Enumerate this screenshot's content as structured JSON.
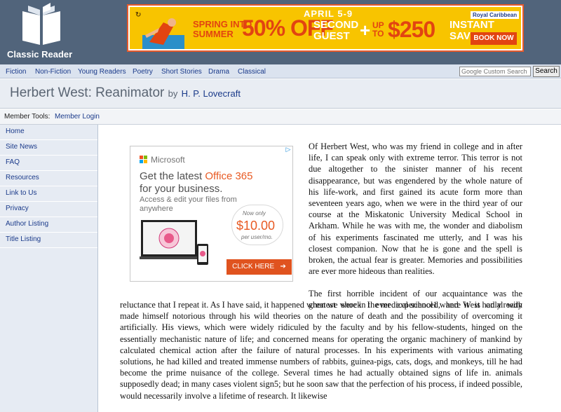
{
  "site": {
    "name": "Classic Reader"
  },
  "banner": {
    "dates": "APRIL 5-9",
    "spring": "SPRING INTO",
    "summer": "SUMMER",
    "off": "50% OFF",
    "second": "SECOND",
    "guest": "GUEST",
    "upto_line1": "UP",
    "upto_line2": "TO",
    "amount": "$250",
    "instant": "INSTANT",
    "savings": "SAVINGS",
    "brand": "Royal Caribbean",
    "cta": "BOOK NOW"
  },
  "nav": {
    "items": [
      "Fiction",
      "Non-Fiction",
      "Young Readers",
      "Poetry",
      "Short Stories",
      "Drama",
      "Classical"
    ]
  },
  "search": {
    "placeholder": "Google Custom Search",
    "button": "Search"
  },
  "book": {
    "title": "Herbert West: Reanimator",
    "by": "by",
    "author": "H. P. Lovecraft"
  },
  "member": {
    "label": "Member Tools:",
    "login": "Member Login"
  },
  "sidebar": {
    "items": [
      "Home",
      "Site News",
      "FAQ",
      "Resources",
      "Link to Us",
      "Privacy",
      "Author Listing",
      "Title Listing"
    ]
  },
  "ad": {
    "brand": "Microsoft",
    "headline_pre": "Get the latest ",
    "headline_accent": "Office 365",
    "headline_post": "for your business.",
    "sub": "Access & edit your files from anywhere",
    "price_top": "Now only",
    "price": "$10.00",
    "price_bottom": "per user/mo.",
    "cta": "CLICK HERE",
    "adchoices": "▷"
  },
  "text": {
    "p1": "Of Herbert West, who was my friend in college and in after life, I can speak only with extreme terror. This terror is not due altogether to the sinister manner of his recent disappearance, but was engendered by the whole nature of his life-work, and first gained its acute form more than seventeen years ago, when we were in the third year of our course at the Miskatonic University Medical School in Arkham. While he was with me, the wonder and diabolism of his experiments fascinated me utterly, and I was his closest companion. Now that he is gone and the spell is broken, the actual fear is greater. Memories and possibilities are ever more hideous than realities.",
    "p2a": "The first horrible incident of our acquaintance was the greatest shock I ever experienced, and it is only with",
    "p2b": "reluctance that I repeat it. As I have said, it happened when we were in the medical school1 where West had already made himself notorious through his wild theories on the nature of death and the possibility of overcoming it artificially. His views, which were widely ridiculed by the faculty and by his fellow-students, hinged on the essentially mechanistic nature of life; and concerned means for operating the organic machinery of mankind by calculated chemical action after the failure of natural processes. In his experiments with various animating solutions, he had killed and treated immense numbers of rabbits, guinea-pigs, cats, dogs, and monkeys, till he had become the prime nuisance of the college. Several times he had actually obtained signs of life in. animals supposedly dead; in many cases violent sign5; but he soon saw that the perfection of his process, if indeed possible, would necessarily involve a lifetime of research. It likewise"
  }
}
